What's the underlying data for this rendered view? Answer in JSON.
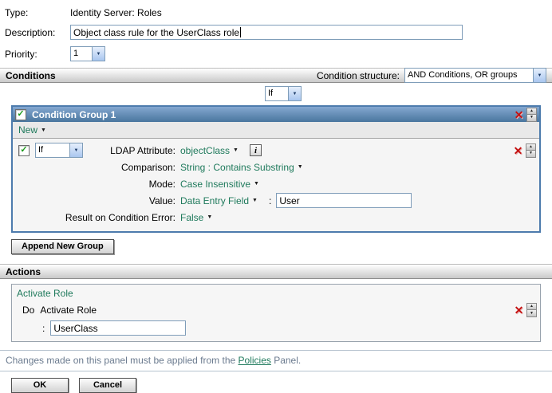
{
  "colors": {
    "group_header_blue": "#4d7bad",
    "link_green": "#1f7a5c",
    "delete_red": "#c41111",
    "note_gray": "#6b7b8f",
    "input_border": "#7f9db9"
  },
  "icons": {
    "check": "✓",
    "delete": "✕",
    "up": "▲",
    "down": "▼",
    "dropdown": "▼",
    "caret": "▼",
    "info": "i"
  },
  "form": {
    "type_label": "Type:",
    "type_value": "Identity Server: Roles",
    "description_label": "Description:",
    "description_value": "Object class rule for the UserClass role",
    "priority_label": "Priority:",
    "priority_value": "1"
  },
  "conditions": {
    "header": "Conditions",
    "structure_label": "Condition structure:",
    "structure_value": "AND Conditions, OR groups",
    "if_value": "If",
    "group": {
      "title": "Condition Group 1",
      "new_label": "New",
      "condition": {
        "if_value": "If",
        "ldap_label": "LDAP Attribute:",
        "ldap_value": "objectClass",
        "comparison_label": "Comparison:",
        "comparison_value": "String : Contains Substring",
        "mode_label": "Mode:",
        "mode_value": "Case Insensitive",
        "value_label": "Value:",
        "value_source": "Data Entry Field",
        "value_separator": ":",
        "value_text": "User",
        "error_label": "Result on Condition Error:",
        "error_value": "False"
      }
    },
    "append_group_label": "Append New Group"
  },
  "actions": {
    "header": "Actions",
    "group_title": "Activate Role",
    "do_label": "Do",
    "do_action": "Activate Role",
    "value_separator": ":",
    "value_text": "UserClass"
  },
  "footer": {
    "note_prefix": "Changes made on this panel must be applied from the ",
    "note_link": "Policies",
    "note_suffix": " Panel.",
    "ok_label": "OK",
    "cancel_label": "Cancel"
  }
}
